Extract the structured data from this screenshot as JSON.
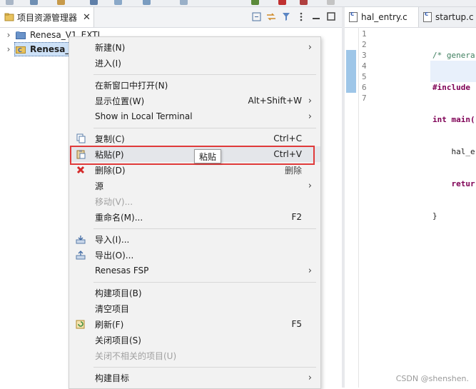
{
  "explorer": {
    "tab_title": "项目资源管理器",
    "tab_close": "✕",
    "tree": [
      {
        "label": "Renesa_V1_EXTI",
        "expanded": false
      },
      {
        "label": "Renesa_V",
        "expanded": false,
        "selected": true
      }
    ]
  },
  "editor": {
    "tabs": [
      {
        "label": "hal_entry.c",
        "active": true
      },
      {
        "label": "startup.c",
        "active": false
      }
    ],
    "line_numbers": [
      "1",
      "2",
      "3",
      "4",
      "5",
      "6",
      "7"
    ],
    "code_lines": [
      "/* genera",
      "#include ",
      "int main(",
      "    hal_e",
      "    retur",
      "}",
      ""
    ]
  },
  "context_menu": {
    "items": [
      {
        "label": "新建(N)",
        "submenu": true
      },
      {
        "label": "进入(I)"
      },
      {
        "label": "在新窗口中打开(N)"
      },
      {
        "label": "显示位置(W)",
        "shortcut": "Alt+Shift+W",
        "submenu": true
      },
      {
        "label": "Show in Local Terminal",
        "submenu": true
      },
      {
        "label": "复制(C)",
        "shortcut": "Ctrl+C",
        "icon": "copy-icon"
      },
      {
        "label": "粘贴(P)",
        "shortcut": "Ctrl+V",
        "icon": "paste-icon",
        "highlighted": true
      },
      {
        "label": "删除(D)",
        "shortcut": "删除",
        "icon": "delete-icon"
      },
      {
        "label": "源",
        "submenu": true
      },
      {
        "label": "移动(V)...",
        "disabled": true
      },
      {
        "label": "重命名(M)...",
        "shortcut": "F2"
      },
      {
        "label": "导入(I)...",
        "icon": "import-icon"
      },
      {
        "label": "导出(O)...",
        "icon": "export-icon"
      },
      {
        "label": "Renesas FSP",
        "submenu": true
      },
      {
        "label": "构建项目(B)"
      },
      {
        "label": "清空项目"
      },
      {
        "label": "刷新(F)",
        "shortcut": "F5",
        "icon": "refresh-icon"
      },
      {
        "label": "关闭项目(S)"
      },
      {
        "label": "关闭不相关的项目(U)",
        "disabled": true
      },
      {
        "label": "构建目标",
        "submenu": true
      }
    ],
    "submenu_arrow": "›"
  },
  "tooltip": {
    "text": "粘贴"
  },
  "watermark": {
    "text": "CSDN @shenshen."
  },
  "colors": {
    "highlight_border": "#e03a3a",
    "selection": "#cde1f7",
    "menu_bg": "#f2f2f2",
    "keyword": "#7f0055",
    "comment": "#3f7f5f"
  }
}
